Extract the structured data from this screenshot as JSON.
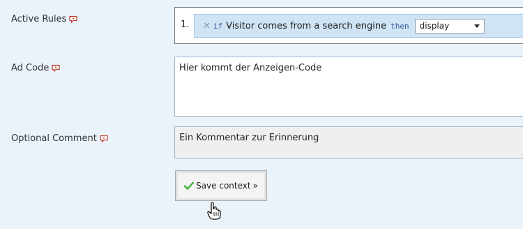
{
  "form": {
    "active_rules": {
      "label": "Active Rules",
      "rules": [
        {
          "number": "1.",
          "remove": "✕",
          "if_keyword": "if",
          "condition": "Visitor comes from a search engine",
          "then_keyword": "then",
          "action": "display"
        }
      ]
    },
    "ad_code": {
      "label": "Ad Code",
      "value": "Hier kommt der Anzeigen-Code"
    },
    "comment": {
      "label": "Optional Comment",
      "value": "Ein Kommentar zur Erinnerung"
    },
    "save_button": {
      "label": "Save context",
      "suffix": "»"
    }
  },
  "icons": {
    "help": "speech-bubble-help-icon",
    "check": "check-icon",
    "cursor": "hand-pointer-icon"
  },
  "colors": {
    "background": "#eaf2fa",
    "rule_bg": "#cfe4f5",
    "help_icon": "#c0392b",
    "check": "#3bb33b"
  }
}
